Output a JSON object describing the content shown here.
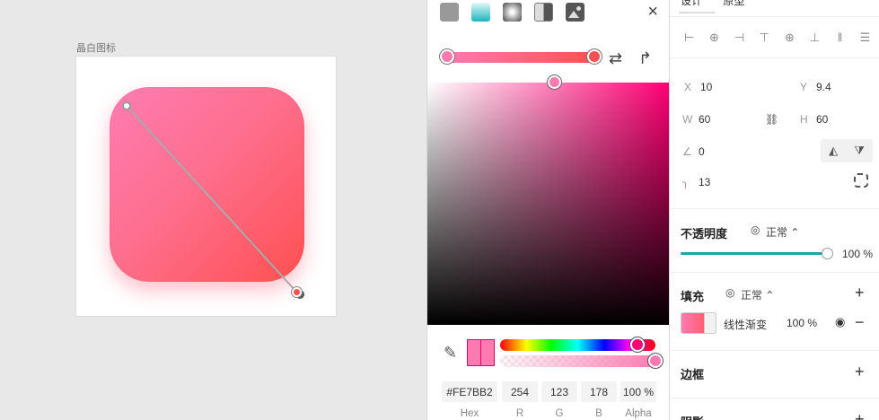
{
  "canvas": {
    "artboard_label": "晶白图标",
    "gradient": {
      "start_color": "#FE7BB2",
      "end_color": "#FE5050"
    }
  },
  "picker": {
    "fill_types": [
      "solid-fill-icon",
      "linear-gradient-icon",
      "radial-gradient-icon",
      "angular-gradient-icon",
      "image-fill-icon"
    ],
    "close_icon": "×",
    "swap_icon": "⇄",
    "redo_icon": "↱",
    "eyedropper_icon": "✎",
    "hex": "#FE7BB2",
    "r": "254",
    "g": "123",
    "b": "178",
    "alpha": "100 %",
    "labels": {
      "hex": "Hex",
      "r": "R",
      "g": "G",
      "b": "B",
      "alpha": "Alpha"
    },
    "hue_color": "#FE0074"
  },
  "inspector": {
    "tabs": [
      "设计",
      "原型"
    ],
    "align_icons": [
      "⊢",
      "⊕",
      "⊣",
      "⊤",
      "⊕",
      "⊥",
      "‖",
      "☰"
    ],
    "x_label": "X",
    "x_value": "10",
    "y_label": "Y",
    "y_value": "9.4",
    "w_label": "W",
    "w_value": "60",
    "h_label": "H",
    "h_value": "60",
    "link_icon": "⛓",
    "angle_icon": "∠",
    "angle_value": "0",
    "radius_icon": "╮",
    "radius_value": "13",
    "flip_h_icon": "◭",
    "flip_v_icon": "⧩",
    "opacity": {
      "title": "不透明度",
      "blend_icon": "◎",
      "blend": "正常 ⌃",
      "value": "100 %",
      "level": 1.0
    },
    "fill": {
      "title": "填充",
      "blend_icon": "◎",
      "blend": "正常 ⌃",
      "plus": "+",
      "type": "线性渐变",
      "opacity": "100 %",
      "eye_icon": "◉",
      "minus": "−"
    },
    "border": {
      "title": "边框",
      "plus": "+"
    },
    "shadow": {
      "title": "阴影",
      "plus": "+"
    },
    "accent": "#1aa5a8"
  }
}
